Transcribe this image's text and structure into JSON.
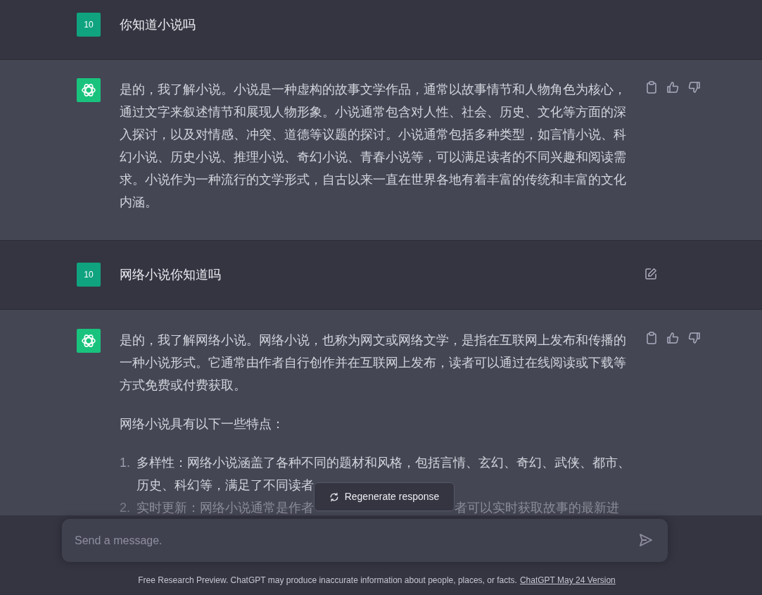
{
  "messages": [
    {
      "kind": "user",
      "avatar": "10",
      "text": "你知道小说吗",
      "show_edit": false
    },
    {
      "kind": "assistant",
      "paragraphs": [
        "是的，我了解小说。小说是一种虚构的故事文学作品，通常以故事情节和人物角色为核心，通过文字来叙述情节和展现人物形象。小说通常包含对人性、社会、历史、文化等方面的深入探讨，以及对情感、冲突、道德等议题的探讨。小说通常包括多种类型，如言情小说、科幻小说、历史小说、推理小说、奇幻小说、青春小说等，可以满足读者的不同兴趣和阅读需求。小说作为一种流行的文学形式，自古以来一直在世界各地有着丰富的传统和丰富的文化内涵。"
      ]
    },
    {
      "kind": "user",
      "avatar": "10",
      "text": "网络小说你知道吗",
      "show_edit": true
    },
    {
      "kind": "assistant",
      "paragraphs": [
        "是的，我了解网络小说。网络小说，也称为网文或网络文学，是指在互联网上发布和传播的一种小说形式。它通常由作者自行创作并在互联网上发布，读者可以通过在线阅读或下载等方式免费或付费获取。",
        "网络小说具有以下一些特点："
      ],
      "list": [
        {
          "number": "1.",
          "text": "多样性：网络小说涵盖了各种不同的题材和风格，包括言情、玄幻、奇幻、武侠、都市、历史、科幻等，满足了不同读者",
          "dimmed": false
        },
        {
          "number": "2.",
          "text": "实时更新：网络小说通常是作者",
          "text_after": "者可以实时获取故事的最新进",
          "dimmed": true
        }
      ]
    }
  ],
  "regenerate_button": "Regenerate response",
  "composer": {
    "placeholder": "Send a message."
  },
  "footer": {
    "text": "Free Research Preview. ChatGPT may produce inaccurate information about people, places, or facts.",
    "link": "ChatGPT May 24 Version"
  }
}
